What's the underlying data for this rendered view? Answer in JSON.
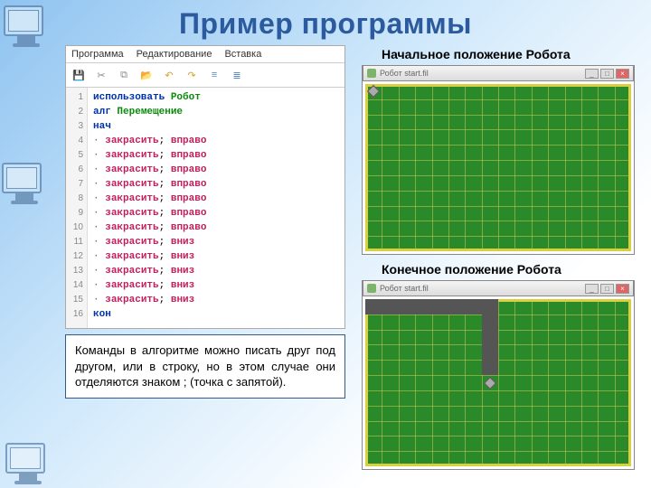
{
  "title": "Пример программы",
  "editor": {
    "menu": [
      "Программа",
      "Редактирование",
      "Вставка"
    ],
    "lines": [
      {
        "n": 1,
        "html": "<span class='kw'>использовать</span> <span class='ident'>Робот</span>"
      },
      {
        "n": 2,
        "html": "<span class='kw'>алг</span> <span class='ident'>Перемещение</span>"
      },
      {
        "n": 3,
        "html": "<span class='kw'>нач</span>"
      },
      {
        "n": 4,
        "html": "<span class='bullet'>·</span> <span class='cmd'>закрасить</span>; <span class='cmd'>вправо</span>"
      },
      {
        "n": 5,
        "html": "<span class='bullet'>·</span> <span class='cmd'>закрасить</span>; <span class='cmd'>вправо</span>"
      },
      {
        "n": 6,
        "html": "<span class='bullet'>·</span> <span class='cmd'>закрасить</span>; <span class='cmd'>вправо</span>"
      },
      {
        "n": 7,
        "html": "<span class='bullet'>·</span> <span class='cmd'>закрасить</span>; <span class='cmd'>вправо</span>"
      },
      {
        "n": 8,
        "html": "<span class='bullet'>·</span> <span class='cmd'>закрасить</span>; <span class='cmd'>вправо</span>"
      },
      {
        "n": 9,
        "html": "<span class='bullet'>·</span> <span class='cmd'>закрасить</span>; <span class='cmd'>вправо</span>"
      },
      {
        "n": 10,
        "html": "<span class='bullet'>·</span> <span class='cmd'>закрасить</span>; <span class='cmd'>вправо</span>"
      },
      {
        "n": 11,
        "html": "<span class='bullet'>·</span> <span class='cmd'>закрасить</span>; <span class='cmd'>вниз</span>"
      },
      {
        "n": 12,
        "html": "<span class='bullet'>·</span> <span class='cmd'>закрасить</span>; <span class='cmd'>вниз</span>"
      },
      {
        "n": 13,
        "html": "<span class='bullet'>·</span> <span class='cmd'>закрасить</span>; <span class='cmd'>вниз</span>"
      },
      {
        "n": 14,
        "html": "<span class='bullet'>·</span> <span class='cmd'>закрасить</span>; <span class='cmd'>вниз</span>"
      },
      {
        "n": 15,
        "html": "<span class='bullet'>·</span> <span class='cmd'>закрасить</span>; <span class='cmd'>вниз</span>"
      },
      {
        "n": 16,
        "html": "<span class='kw'>кон</span>"
      }
    ]
  },
  "explanation": "Команды в алгоритме можно писать друг под другом, или в строку, но в этом случае они отделяются знаком ; (точка с запятой).",
  "right": {
    "cap1": "Начальное положение Робота",
    "cap2": "Конечное положение Робота",
    "wintitle": "Робот  start.fil"
  },
  "grid": {
    "cols": 16,
    "rows": 11
  },
  "initial_robot": {
    "col": 1,
    "row": 1
  },
  "final": {
    "fills": {
      "hrow": 1,
      "hcount": 8,
      "vcol": 8,
      "vfrom": 1,
      "vcount": 5
    },
    "robot": {
      "col": 8,
      "row": 6
    }
  }
}
